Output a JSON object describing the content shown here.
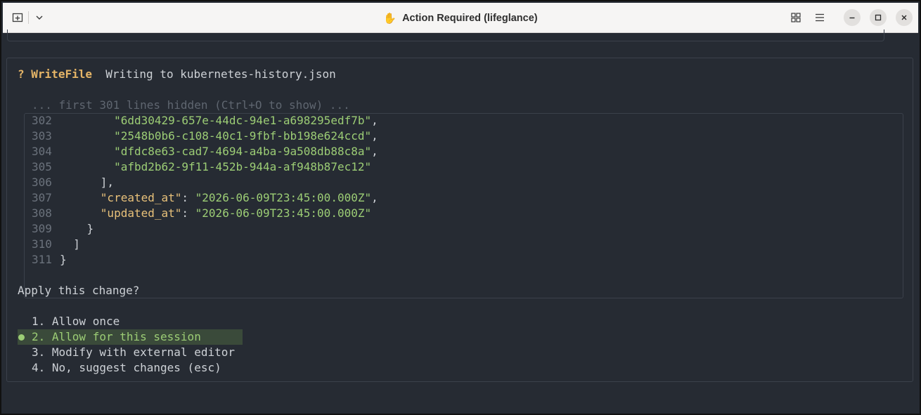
{
  "window": {
    "title": "Action Required (lifeglance)",
    "title_icon": "✋"
  },
  "titlebar": {
    "left_buttons": [
      "new-tab-icon",
      "chevron-down-icon"
    ],
    "right_buttons": [
      "grid-view-icon",
      "hamburger-menu-icon",
      "minimize-icon",
      "maximize-icon",
      "close-icon"
    ]
  },
  "tool": {
    "marker": "?",
    "name": "WriteFile",
    "description": "Writing to kubernetes-history.json"
  },
  "code": {
    "hidden_note": "... first 301 lines hidden (Ctrl+O to show) ...",
    "lines": [
      {
        "num": "302",
        "text": "        \"6dd30429-657e-44dc-94e1-a698295edf7b\","
      },
      {
        "num": "303",
        "text": "        \"2548b0b6-c108-40c1-9fbf-bb198e624ccd\","
      },
      {
        "num": "304",
        "text": "        \"dfdc8e63-cad7-4694-a4ba-9a508db88c8a\","
      },
      {
        "num": "305",
        "text": "        \"afbd2b62-9f11-452b-944a-af948b87ec12\""
      },
      {
        "num": "306",
        "text": "      ],"
      },
      {
        "num": "307",
        "key": "\"created_at\"",
        "sep": ": ",
        "value": "\"2026-06-09T23:45:00.000Z\"",
        "end": ",",
        "indent": "      "
      },
      {
        "num": "308",
        "key": "\"updated_at\"",
        "sep": ": ",
        "value": "\"2026-06-09T23:45:00.000Z\"",
        "end": "",
        "indent": "      "
      },
      {
        "num": "309",
        "text": "    }"
      },
      {
        "num": "310",
        "text": "  ]"
      },
      {
        "num": "311",
        "text": "}"
      }
    ]
  },
  "prompt": {
    "question": "Apply this change?",
    "options": [
      "1. Allow once",
      "2. Allow for this session",
      "3. Modify with external editor",
      "4. No, suggest changes (esc)"
    ],
    "selected_index": 1
  },
  "colors": {
    "background": "#262b33",
    "accent_yellow": "#e5b567",
    "string_green": "#9ccd75",
    "selection_bg": "#3a4a3a"
  }
}
